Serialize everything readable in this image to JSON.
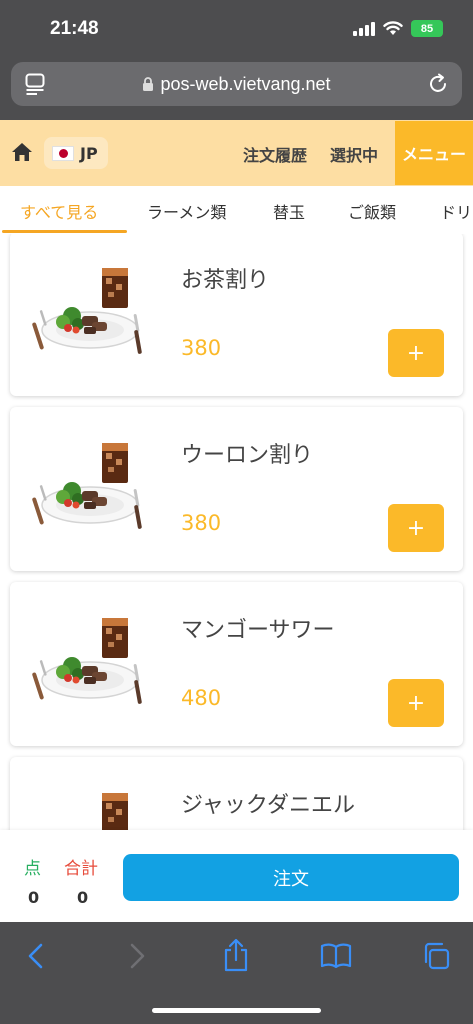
{
  "status_bar": {
    "time": "21:48",
    "battery": "85"
  },
  "browser": {
    "url": "pos-web.vietvang.net"
  },
  "header": {
    "language": "JP",
    "order_history": "注文履歴",
    "selected": "選択中",
    "menu": "メニュー"
  },
  "categories": [
    "すべて見る",
    "ラーメン類",
    "替玉",
    "ご飯類",
    "ドリ"
  ],
  "active_category": "すべて見る",
  "items": [
    {
      "name": "お茶割り",
      "price": "380",
      "add_label": "+"
    },
    {
      "name": "ウーロン割り",
      "price": "380",
      "add_label": "+"
    },
    {
      "name": "マンゴーサワー",
      "price": "480",
      "add_label": "+"
    },
    {
      "name": "ジャックダニエル",
      "price": "",
      "add_label": "+"
    }
  ],
  "footer": {
    "count_label": "点",
    "total_label": "合計",
    "count_value": "0",
    "total_value": "0",
    "order_button": "注文"
  },
  "colors": {
    "accent": "#fbb929",
    "header_bg": "#fddea3",
    "order_button": "#12a1e3",
    "count_label": "#27ae60",
    "total_label": "#e74c3c"
  },
  "icons": {
    "home": "home-icon",
    "add": "plus-icon",
    "share": "share-icon",
    "bookmarks": "book-icon",
    "tabs": "tabs-icon"
  }
}
